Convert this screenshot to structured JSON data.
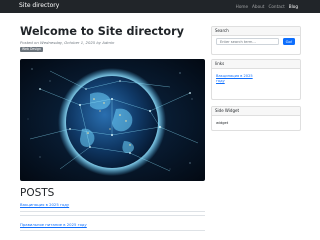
{
  "navbar": {
    "brand": "Site directory",
    "links": [
      {
        "label": "Home",
        "active": false
      },
      {
        "label": "About",
        "active": false
      },
      {
        "label": "Contact",
        "active": false
      },
      {
        "label": "Blog",
        "active": true
      }
    ]
  },
  "post": {
    "title": "Welcome to Site directory",
    "meta": "Posted on Wednesday, October 1, 2025 by Admin",
    "tag": "Web Design",
    "image_icon": "earth-network-image"
  },
  "posts_section": {
    "heading": "POSTS",
    "items": [
      "Вакцинация в 2025 году",
      "Правильное питание в 2025 году"
    ]
  },
  "sidebar": {
    "search": {
      "header": "Search",
      "placeholder": "Enter search term...",
      "button": "Go!"
    },
    "links": {
      "header": "links",
      "items": [
        "Вакцинация в 2025",
        "году"
      ]
    },
    "widget": {
      "header": "Side Widget",
      "text": "widget"
    }
  },
  "colors": {
    "navbar_bg": "#212529",
    "link": "#0d6efd",
    "badge": "#6c757d"
  }
}
